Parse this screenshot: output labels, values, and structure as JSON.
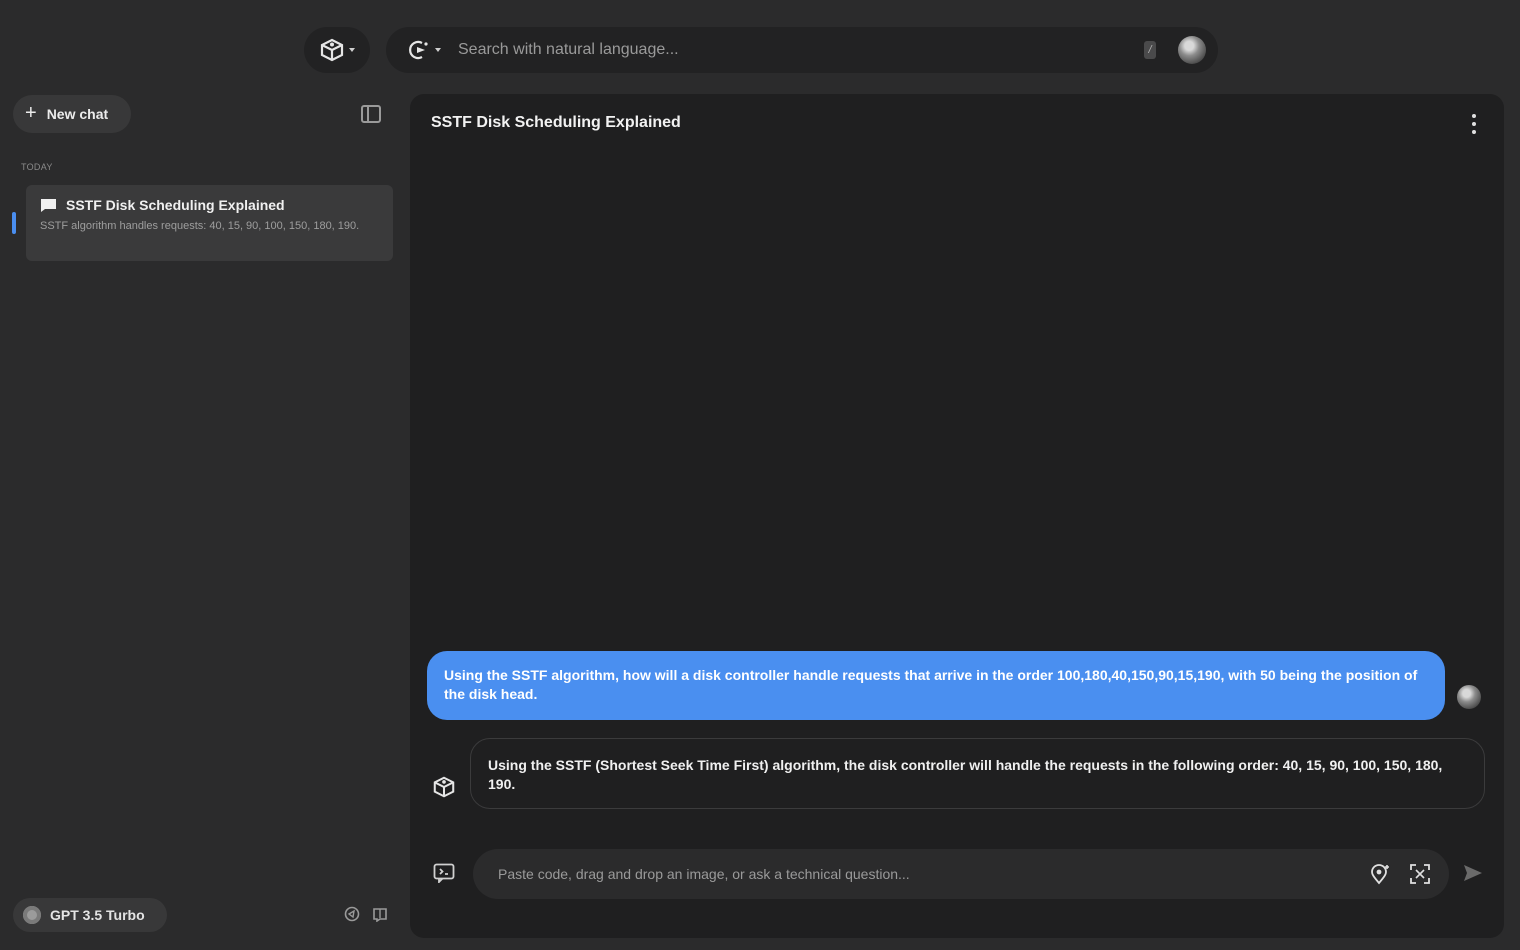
{
  "topbar": {
    "search": {
      "placeholder": "Search with natural language...",
      "shortcut": "/"
    }
  },
  "sidebar": {
    "new_chat_label": "New chat",
    "section_label": "TODAY",
    "chats": [
      {
        "title": "SSTF Disk Scheduling Explained",
        "preview": "SSTF algorithm handles requests: 40, 15, 90, 100, 150, 180, 190."
      }
    ],
    "model": {
      "label": "GPT 3.5 Turbo"
    }
  },
  "main": {
    "title": "SSTF Disk Scheduling Explained",
    "messages": [
      {
        "role": "user",
        "text": "Using the SSTF algorithm, how will a disk controller handle requests that arrive in the order 100,180,40,150,90,15,190, with 50 being the position of the disk head."
      },
      {
        "role": "assistant",
        "text": "Using the SSTF (Shortest Seek Time First) algorithm, the disk controller will handle the requests in the following order: 40, 15, 90, 100, 150, 180, 190."
      }
    ],
    "composer": {
      "placeholder": "Paste code, drag and drop an image, or ask a technical question..."
    }
  },
  "colors": {
    "accent": "#4a8ff0",
    "background": "#2b2b2c",
    "panel": "#1f1f20"
  },
  "icons": [
    "app-logo-icon",
    "search-scope-icon",
    "avatar",
    "plus-icon",
    "sidebar-toggle-icon",
    "chat-bubble-icon",
    "model-icon",
    "kebab-icon",
    "bot-icon",
    "attach-icon",
    "pin-icon",
    "scan-icon",
    "send-icon"
  ]
}
